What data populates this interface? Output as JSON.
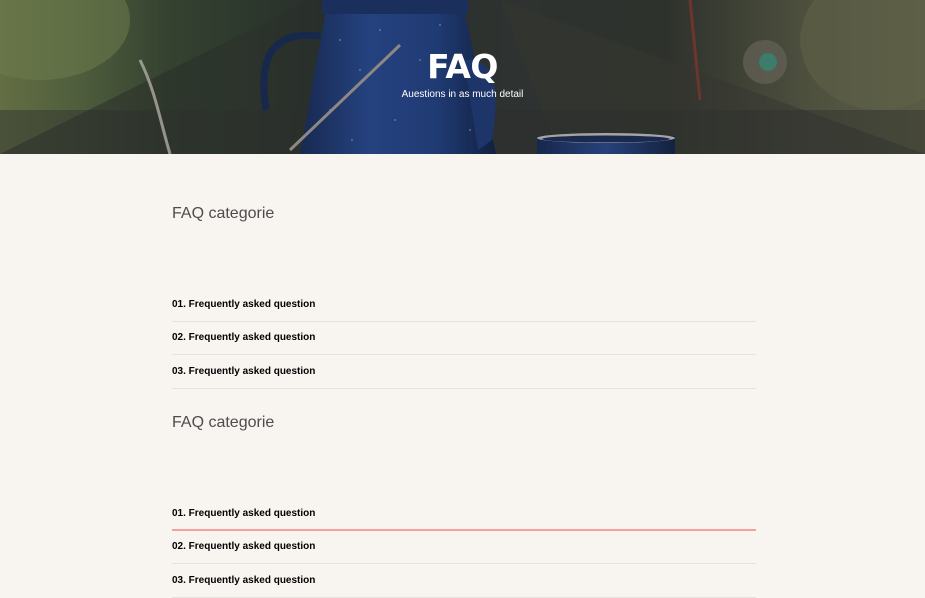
{
  "hero": {
    "title": "FAQ",
    "subtitle": "Auestions in as much detail"
  },
  "sections": [
    {
      "title": "FAQ categorie",
      "questions": [
        {
          "label": "01. Frequently asked question",
          "active": false
        },
        {
          "label": "02. Frequently asked question",
          "active": false
        },
        {
          "label": "03. Frequently asked question",
          "active": false
        }
      ]
    },
    {
      "title": "FAQ categorie",
      "questions": [
        {
          "label": "01. Frequently asked question",
          "active": true
        },
        {
          "label": "02. Frequently asked question",
          "active": false
        },
        {
          "label": "03. Frequently asked question",
          "active": false
        }
      ]
    }
  ],
  "colors": {
    "page_background": "#f8f5f0",
    "active_underline": "#f3a39b",
    "divider": "#e6e2dc",
    "category_text": "#4c4c4c",
    "question_text": "#000000"
  }
}
